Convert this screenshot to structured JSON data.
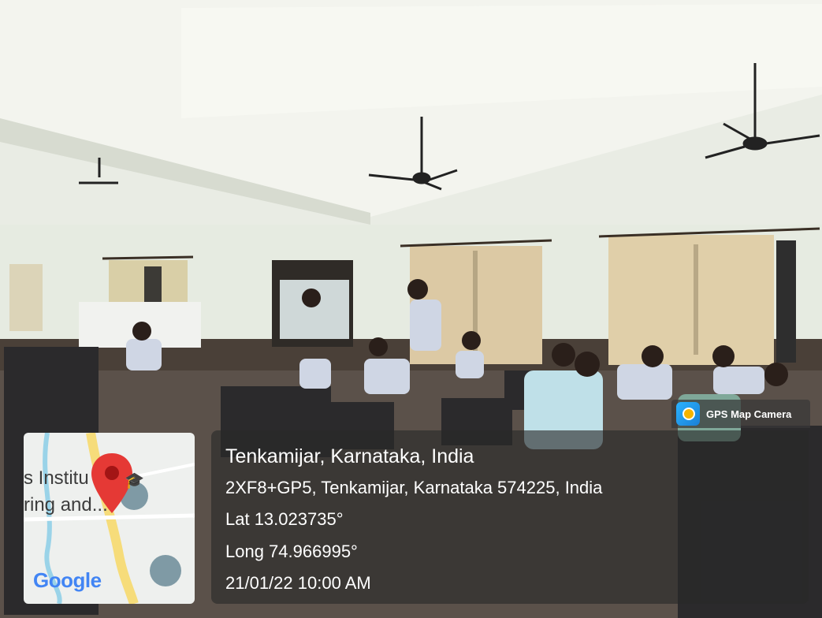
{
  "badge": {
    "title": "GPS Map Camera",
    "icon": "gps-map-camera-app-icon"
  },
  "location": {
    "place": "Tenkamijar, Karnataka, India",
    "address": "2XF8+GP5, Tenkamijar, Karnataka 574225, India",
    "lat": "Lat 13.023735°",
    "long": "Long 74.966995°",
    "datetime": "21/01/22 10:00 AM"
  },
  "map": {
    "label_line1": "s Institu",
    "label_line2": "ring and...",
    "brand": "Google",
    "pin_icon": "location-pin-icon",
    "poi_icon": "graduation-cap-icon"
  },
  "colors": {
    "pin": "#e53935",
    "panel": "#282828",
    "road": "#f6dc7a",
    "water": "#9ad3e8"
  }
}
